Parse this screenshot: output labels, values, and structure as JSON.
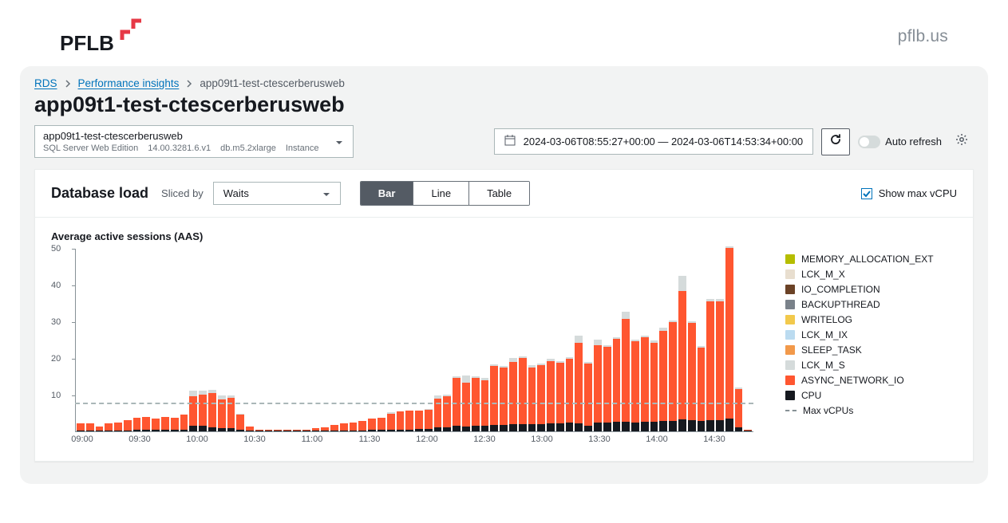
{
  "brand": {
    "name": "PFLB",
    "site_link": "pflb.us"
  },
  "breadcrumb": {
    "items": [
      "RDS",
      "Performance insights"
    ],
    "current": "app09t1-test-ctescerberusweb"
  },
  "page_title": "app09t1-test-ctescerberusweb",
  "instance_selector": {
    "name": "app09t1-test-ctescerberusweb",
    "engine": "SQL Server Web Edition",
    "version": "14.00.3281.6.v1",
    "class": "db.m5.2xlarge",
    "type": "Instance"
  },
  "time_range": "2024-03-06T08:55:27+00:00 — 2024-03-06T14:53:34+00:00",
  "auto_refresh_label": "Auto refresh",
  "panel": {
    "title": "Database load",
    "sliced_by_label": "Sliced by",
    "slice_option": "Waits",
    "view_options": {
      "bar": "Bar",
      "line": "Line",
      "table": "Table"
    },
    "active_view": "bar",
    "show_max_vcpu_label": "Show max vCPU"
  },
  "icons": {
    "calendar": "calendar-icon",
    "refresh": "refresh-icon",
    "gear": "gear-icon",
    "caret": "caret-down-icon",
    "chevron": "chevron-right-icon"
  },
  "chart_data": {
    "type": "bar",
    "title": "Average active sessions (AAS)",
    "ylabel": "",
    "xlabel": "",
    "ylim": [
      0,
      50
    ],
    "yticks": [
      10,
      20,
      30,
      40,
      50
    ],
    "max_vcpu": 8,
    "x_axis_labels": [
      {
        "label": "09:00",
        "position_index": 1
      },
      {
        "label": "09:30",
        "position_index": 7
      },
      {
        "label": "10:00",
        "position_index": 13
      },
      {
        "label": "10:30",
        "position_index": 19
      },
      {
        "label": "11:00",
        "position_index": 25
      },
      {
        "label": "11:30",
        "position_index": 31
      },
      {
        "label": "12:00",
        "position_index": 37
      },
      {
        "label": "12:30",
        "position_index": 43
      },
      {
        "label": "13:00",
        "position_index": 49
      },
      {
        "label": "13:30",
        "position_index": 55
      },
      {
        "label": "14:00",
        "position_index": 61
      },
      {
        "label": "14:30",
        "position_index": 67
      }
    ],
    "legend": [
      {
        "name": "MEMORY_ALLOCATION_EXT",
        "color": "#b5bd00"
      },
      {
        "name": "LCK_M_X",
        "color": "#e8decf"
      },
      {
        "name": "IO_COMPLETION",
        "color": "#6b4226"
      },
      {
        "name": "BACKUPTHREAD",
        "color": "#7a828a"
      },
      {
        "name": "WRITELOG",
        "color": "#f2c94c"
      },
      {
        "name": "LCK_M_IX",
        "color": "#bbdbf0"
      },
      {
        "name": "SLEEP_TASK",
        "color": "#f2994a"
      },
      {
        "name": "LCK_M_S",
        "color": "#d5dbdb"
      },
      {
        "name": "ASYNC_NETWORK_IO",
        "color": "#ff5630"
      },
      {
        "name": "CPU",
        "color": "#16191f"
      }
    ],
    "max_vcpu_label": "Max vCPUs",
    "stacks": [
      {
        "cpu": 0.3,
        "async": 1.8,
        "other": 0
      },
      {
        "cpu": 0.3,
        "async": 1.9,
        "other": 0
      },
      {
        "cpu": 0.3,
        "async": 1.0,
        "other": 0
      },
      {
        "cpu": 0.3,
        "async": 1.8,
        "other": 0
      },
      {
        "cpu": 0.3,
        "async": 2.2,
        "other": 0
      },
      {
        "cpu": 0.3,
        "async": 2.8,
        "other": 0
      },
      {
        "cpu": 0.5,
        "async": 3.3,
        "other": 0
      },
      {
        "cpu": 0.4,
        "async": 3.5,
        "other": 0
      },
      {
        "cpu": 0.4,
        "async": 3.1,
        "other": 0
      },
      {
        "cpu": 0.4,
        "async": 3.5,
        "other": 0
      },
      {
        "cpu": 0.4,
        "async": 3.2,
        "other": 0
      },
      {
        "cpu": 0.5,
        "async": 4.0,
        "other": 0
      },
      {
        "cpu": 1.5,
        "async": 8.0,
        "other": 1.5
      },
      {
        "cpu": 1.5,
        "async": 8.5,
        "other": 1.2
      },
      {
        "cpu": 1.0,
        "async": 9.5,
        "other": 0.8
      },
      {
        "cpu": 0.8,
        "async": 8.0,
        "other": 1.0
      },
      {
        "cpu": 0.8,
        "async": 8.3,
        "other": 0.6
      },
      {
        "cpu": 0.5,
        "async": 4.0,
        "other": 0.3
      },
      {
        "cpu": 0.3,
        "async": 1.0,
        "other": 0
      },
      {
        "cpu": 0.2,
        "async": 0.3,
        "other": 0
      },
      {
        "cpu": 0.2,
        "async": 0.3,
        "other": 0
      },
      {
        "cpu": 0.2,
        "async": 0.3,
        "other": 0
      },
      {
        "cpu": 0.2,
        "async": 0.3,
        "other": 0
      },
      {
        "cpu": 0.2,
        "async": 0.3,
        "other": 0
      },
      {
        "cpu": 0.2,
        "async": 0.2,
        "other": 0
      },
      {
        "cpu": 0.2,
        "async": 0.6,
        "other": 0
      },
      {
        "cpu": 0.2,
        "async": 0.8,
        "other": 0
      },
      {
        "cpu": 0.3,
        "async": 1.5,
        "other": 0
      },
      {
        "cpu": 0.3,
        "async": 1.8,
        "other": 0
      },
      {
        "cpu": 0.3,
        "async": 2.2,
        "other": 0
      },
      {
        "cpu": 0.3,
        "async": 2.6,
        "other": 0
      },
      {
        "cpu": 0.4,
        "async": 3.0,
        "other": 0
      },
      {
        "cpu": 0.4,
        "async": 3.4,
        "other": 0
      },
      {
        "cpu": 0.5,
        "async": 4.2,
        "other": 0.5
      },
      {
        "cpu": 0.5,
        "async": 5.0,
        "other": 0
      },
      {
        "cpu": 0.5,
        "async": 5.2,
        "other": 0
      },
      {
        "cpu": 0.6,
        "async": 5.0,
        "other": 0
      },
      {
        "cpu": 0.6,
        "async": 5.2,
        "other": 0.4
      },
      {
        "cpu": 1.0,
        "async": 8.0,
        "other": 0.8
      },
      {
        "cpu": 1.0,
        "async": 8.5,
        "other": 0.5
      },
      {
        "cpu": 1.5,
        "async": 13.0,
        "other": 0.5
      },
      {
        "cpu": 1.3,
        "async": 12.0,
        "other": 2.0
      },
      {
        "cpu": 1.5,
        "async": 13.0,
        "other": 0.5
      },
      {
        "cpu": 1.5,
        "async": 12.5,
        "other": 0.5
      },
      {
        "cpu": 1.8,
        "async": 16.0,
        "other": 0.5
      },
      {
        "cpu": 1.8,
        "async": 15.5,
        "other": 0.5
      },
      {
        "cpu": 2.0,
        "async": 17.0,
        "other": 1.0
      },
      {
        "cpu": 2.0,
        "async": 18.0,
        "other": 0.5
      },
      {
        "cpu": 2.0,
        "async": 15.5,
        "other": 0.5
      },
      {
        "cpu": 2.0,
        "async": 16.0,
        "other": 0.5
      },
      {
        "cpu": 2.2,
        "async": 17.0,
        "other": 0.5
      },
      {
        "cpu": 2.2,
        "async": 16.5,
        "other": 0.5
      },
      {
        "cpu": 2.3,
        "async": 17.5,
        "other": 0.5
      },
      {
        "cpu": 2.2,
        "async": 22.0,
        "other": 2.0
      },
      {
        "cpu": 1.5,
        "async": 17.0,
        "other": 0.5
      },
      {
        "cpu": 2.5,
        "async": 21.0,
        "other": 1.5
      },
      {
        "cpu": 2.5,
        "async": 20.5,
        "other": 0.5
      },
      {
        "cpu": 2.7,
        "async": 22.5,
        "other": 0.5
      },
      {
        "cpu": 2.6,
        "async": 28.0,
        "other": 2.0
      },
      {
        "cpu": 2.5,
        "async": 22.0,
        "other": 0.5
      },
      {
        "cpu": 2.7,
        "async": 23.0,
        "other": 0.5
      },
      {
        "cpu": 2.7,
        "async": 21.5,
        "other": 0.5
      },
      {
        "cpu": 2.8,
        "async": 24.5,
        "other": 1.0
      },
      {
        "cpu": 2.8,
        "async": 27.0,
        "other": 0.5
      },
      {
        "cpu": 3.3,
        "async": 35.0,
        "other": 4.0
      },
      {
        "cpu": 3.0,
        "async": 26.5,
        "other": 0.5
      },
      {
        "cpu": 2.8,
        "async": 20.0,
        "other": 0.5
      },
      {
        "cpu": 3.0,
        "async": 32.5,
        "other": 0.5
      },
      {
        "cpu": 3.0,
        "async": 32.5,
        "other": 0.5
      },
      {
        "cpu": 3.5,
        "async": 46.5,
        "other": 0.5
      },
      {
        "cpu": 1.0,
        "async": 10.5,
        "other": 0.5
      },
      {
        "cpu": 0.3,
        "async": 0.2,
        "other": 0
      }
    ]
  }
}
